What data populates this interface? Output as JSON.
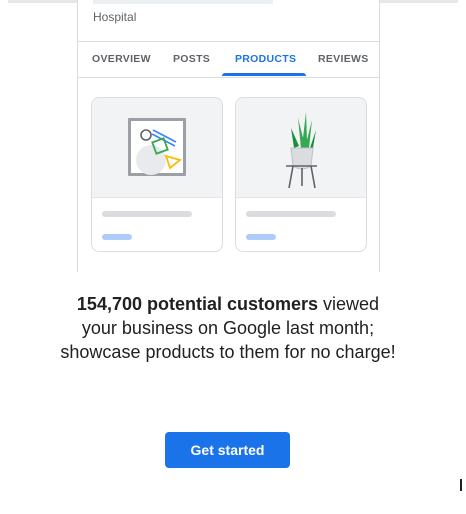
{
  "card": {
    "header_text": "Hospital",
    "tabs": [
      {
        "label": "OVERVIEW",
        "active": false
      },
      {
        "label": "POSTS",
        "active": false
      },
      {
        "label": "PRODUCTS",
        "active": true
      },
      {
        "label": "REVIEWS",
        "active": false
      }
    ],
    "products": [
      {
        "image": "shapes-illustration"
      },
      {
        "image": "potted-plant-illustration"
      }
    ]
  },
  "message": {
    "highlight": "154,700 potential customers",
    "rest": " viewed your business on Google last month; showcase products to them for no charge!"
  },
  "cta": {
    "label": "Get started"
  },
  "colors": {
    "accent": "#1a73e8",
    "text": "#202124",
    "muted": "#5f6368",
    "border": "#dadce0"
  }
}
